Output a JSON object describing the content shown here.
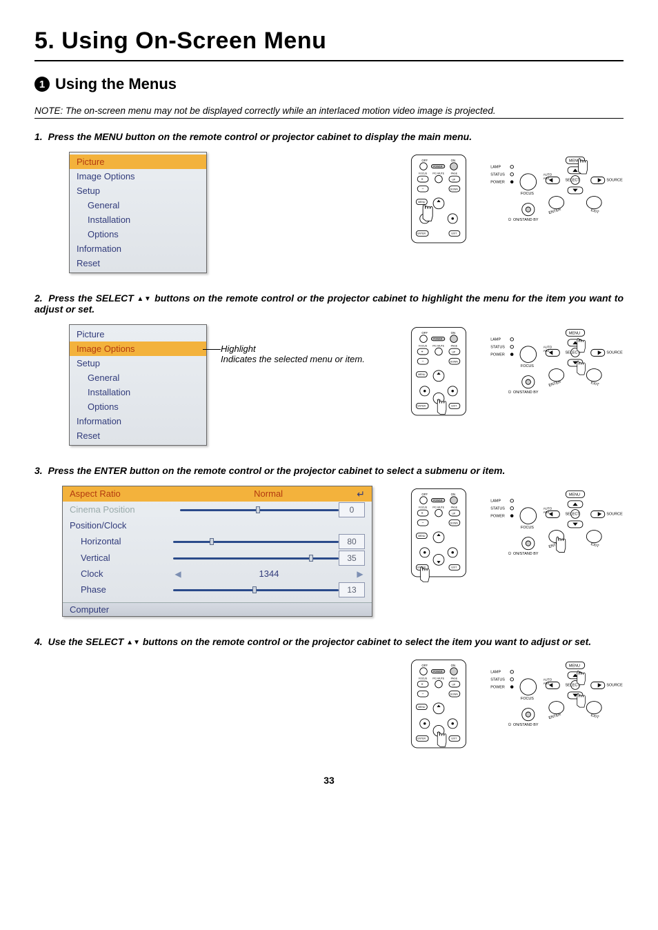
{
  "page_number": "33",
  "title": "5. Using On-Screen Menu",
  "section": {
    "num": "1",
    "heading": "Using the Menus"
  },
  "note": "NOTE: The on-screen menu may not be displayed correctly while an interlaced motion video image is projected.",
  "steps": {
    "s1": {
      "num": "1.",
      "text": "Press the MENU button on the remote control or projector cabinet to display the main menu."
    },
    "s2": {
      "num": "2.",
      "text_a": "Press the SELECT ",
      "text_b": " buttons on the remote control or the projector cabinet to highlight the menu for the item you want to adjust or set."
    },
    "s3": {
      "num": "3.",
      "text": "Press the ENTER button on the remote control or the projector cabinet to select a submenu or item."
    },
    "s4": {
      "num": "4.",
      "text_a": "Use the SELECT ",
      "text_b": " buttons on the remote control or the projector cabinet to select the item you want to adjust or set."
    }
  },
  "menu_items": {
    "picture": "Picture",
    "image_options": "Image Options",
    "setup": "Setup",
    "general": "General",
    "installation": "Installation",
    "options": "Options",
    "information": "Information",
    "reset": "Reset"
  },
  "annotation": {
    "line1": "Highlight",
    "line2": "Indicates the selected menu or item."
  },
  "submenu": {
    "aspect_ratio": "Aspect Ratio",
    "aspect_val": "Normal",
    "cinema_position": "Cinema Position",
    "cinema_val": "0",
    "position_clock": "Position/Clock",
    "horizontal": "Horizontal",
    "horizontal_val": "80",
    "vertical": "Vertical",
    "vertical_val": "35",
    "clock": "Clock",
    "clock_val": "1344",
    "phase": "Phase",
    "phase_val": "13",
    "source": "Computer"
  },
  "remote": {
    "off": "OFF",
    "on": "ON",
    "power": "POWER",
    "focus": "FOCUS",
    "picmute": "PIC-MUTE",
    "page": "PAGE",
    "up": "UP",
    "down": "DOWN",
    "menu": "MENU",
    "enter": "ENTER",
    "exit": "EXIT"
  },
  "panel": {
    "lamp": "LAMP",
    "status": "STATUS",
    "power_ind": "POWER",
    "focus": "FOCUS",
    "onstandby": "ON/STAND BY",
    "menu": "MENU",
    "auto": "AUTO",
    "adj": "ADJ.",
    "select": "SELECT",
    "source": "SOURCE",
    "enter": "ENTER",
    "exit": "EXIT"
  }
}
